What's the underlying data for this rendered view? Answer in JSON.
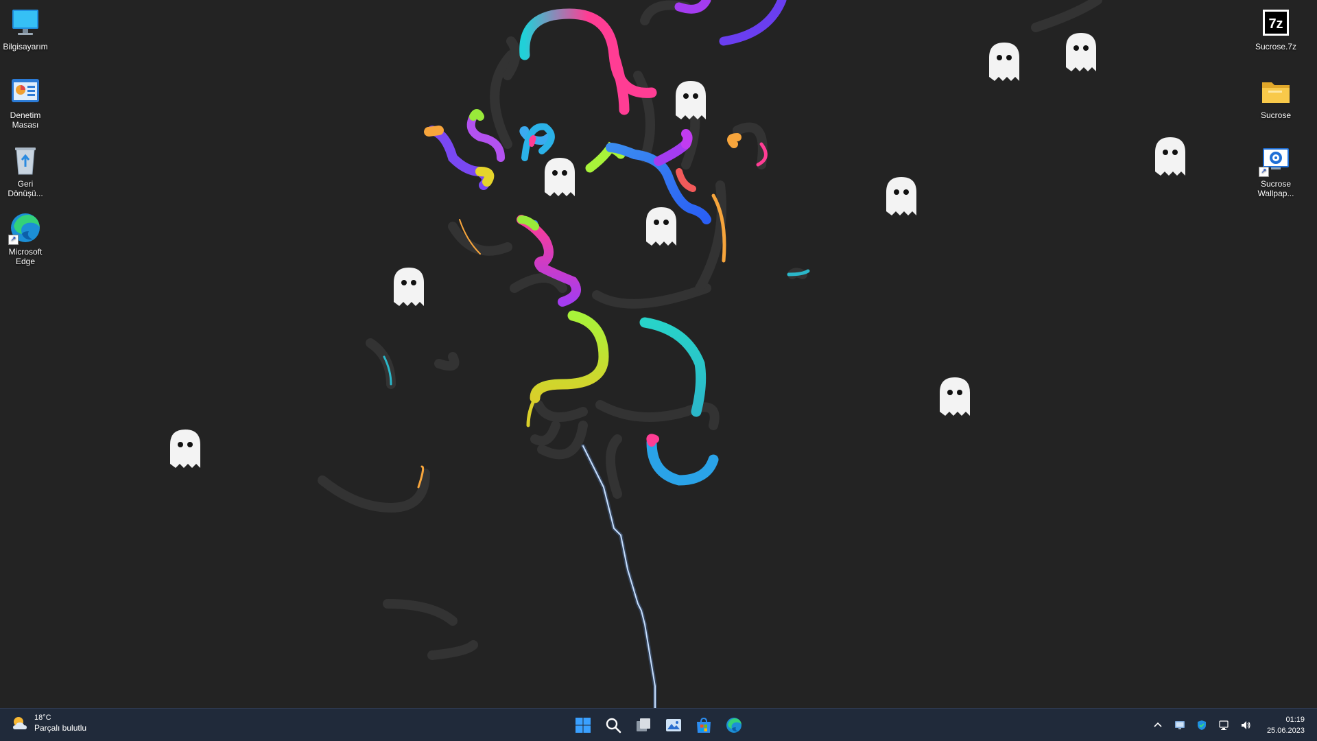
{
  "desktop": {
    "left_icons": [
      {
        "label": "Bilgisayarım",
        "icon": "monitor-icon"
      },
      {
        "label": "Denetim Masası",
        "icon": "control-panel-icon"
      },
      {
        "label": "Geri Dönüşü...",
        "icon": "recycle-bin-icon"
      },
      {
        "label": "Microsoft Edge",
        "icon": "edge-icon"
      }
    ],
    "right_icons": [
      {
        "label": "Sucrose.7z",
        "icon": "7z-archive-icon"
      },
      {
        "label": "Sucrose",
        "icon": "folder-icon"
      },
      {
        "label": "Sucrose Wallpap...",
        "icon": "sucrose-settings-icon"
      }
    ]
  },
  "taskbar": {
    "weather": {
      "temperature": "18°C",
      "condition": "Parçalı bulutlu",
      "icon": "partly-cloudy-icon"
    },
    "apps": [
      {
        "name": "Başlat",
        "icon": "windows-start-icon"
      },
      {
        "name": "Ara",
        "icon": "search-icon"
      },
      {
        "name": "Görev görünümü",
        "icon": "task-view-icon"
      },
      {
        "name": "Galeri",
        "icon": "gallery-icon"
      },
      {
        "name": "Microsoft Store",
        "icon": "store-icon"
      },
      {
        "name": "Microsoft Edge",
        "icon": "edge-icon"
      }
    ],
    "tray": {
      "icons": [
        "chevron-up-icon",
        "monitor-tray-icon",
        "security-shield-icon",
        "network-icon",
        "volume-icon"
      ],
      "time": "01:19",
      "date": "25.06.2023"
    }
  },
  "colors": {
    "desktop_bg": "#232323",
    "taskbar_bg": "#202a3a",
    "accent": "#0078d4"
  }
}
